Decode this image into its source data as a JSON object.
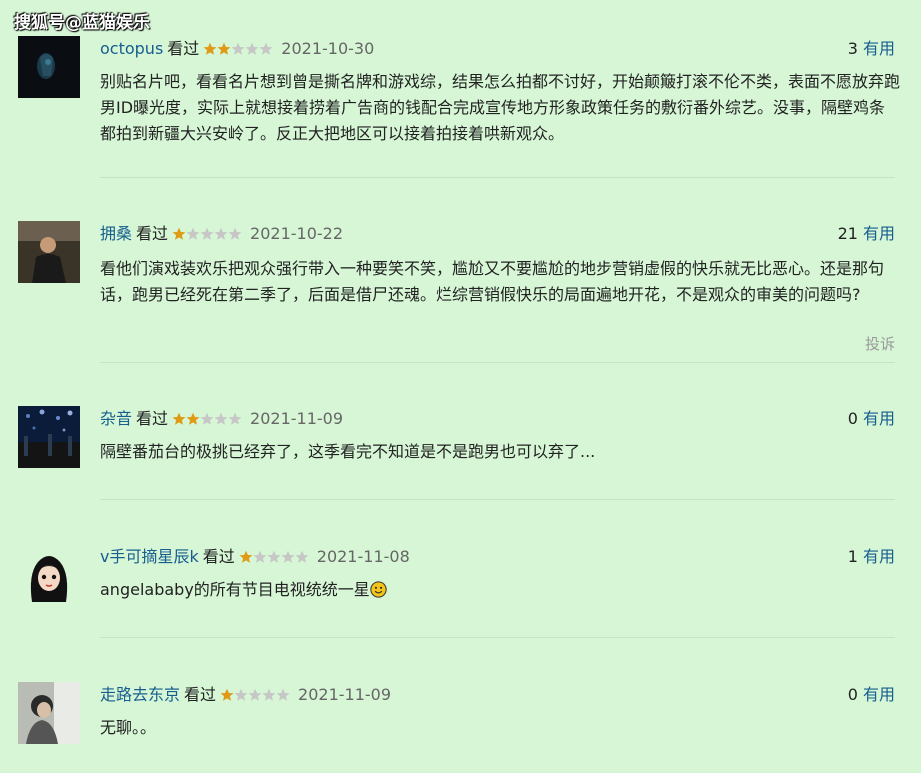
{
  "watermark": "搜狐号@蓝猫娱乐",
  "colors": {
    "background": "#d6f6d6",
    "link": "#175e8f",
    "star_filled": "#e09a15",
    "star_empty": "#c7c7c7"
  },
  "comments": [
    {
      "user": "octopus",
      "status": "看过",
      "rating": 2,
      "date": "2021-10-30",
      "useful_count": "3",
      "useful_label": "有用",
      "text": "别贴名片吧，看看名片想到曾是撕名牌和游戏综，结果怎么拍都不讨好，开始颠簸打滚不伦不类，表面不愿放弃跑男ID曝光度，实际上就想接着捞着广告商的钱配合完成宣传地方形象政策任务的敷衍番外综艺。没事，隔壁鸡条都拍到新疆大兴安岭了。反正大把地区可以接着拍接着哄新观众。"
    },
    {
      "user": "拥桑",
      "status": "看过",
      "rating": 1,
      "date": "2021-10-22",
      "useful_count": "21",
      "useful_label": "有用",
      "text": "看他们演戏装欢乐把观众强行带入一种要笑不笑，尴尬又不要尴尬的地步营销虚假的快乐就无比恶心。还是那句话，跑男已经死在第二季了，后面是借尸还魂。烂综营销假快乐的局面遍地开花，不是观众的审美的问题吗?",
      "report": "投诉"
    },
    {
      "user": "杂音",
      "status": "看过",
      "rating": 2,
      "date": "2021-11-09",
      "useful_count": "0",
      "useful_label": "有用",
      "text": "隔壁番茄台的极挑已经弃了，这季看完不知道是不是跑男也可以弃了..."
    },
    {
      "user": "v手可摘星辰k",
      "status": "看过",
      "rating": 1,
      "date": "2021-11-08",
      "useful_count": "1",
      "useful_label": "有用",
      "text": "angelababy的所有节目电视统统一星",
      "emoji": "smiley-face-icon"
    },
    {
      "user": "走路去东京",
      "status": "看过",
      "rating": 1,
      "date": "2021-11-09",
      "useful_count": "0",
      "useful_label": "有用",
      "text": "无聊。。"
    }
  ]
}
